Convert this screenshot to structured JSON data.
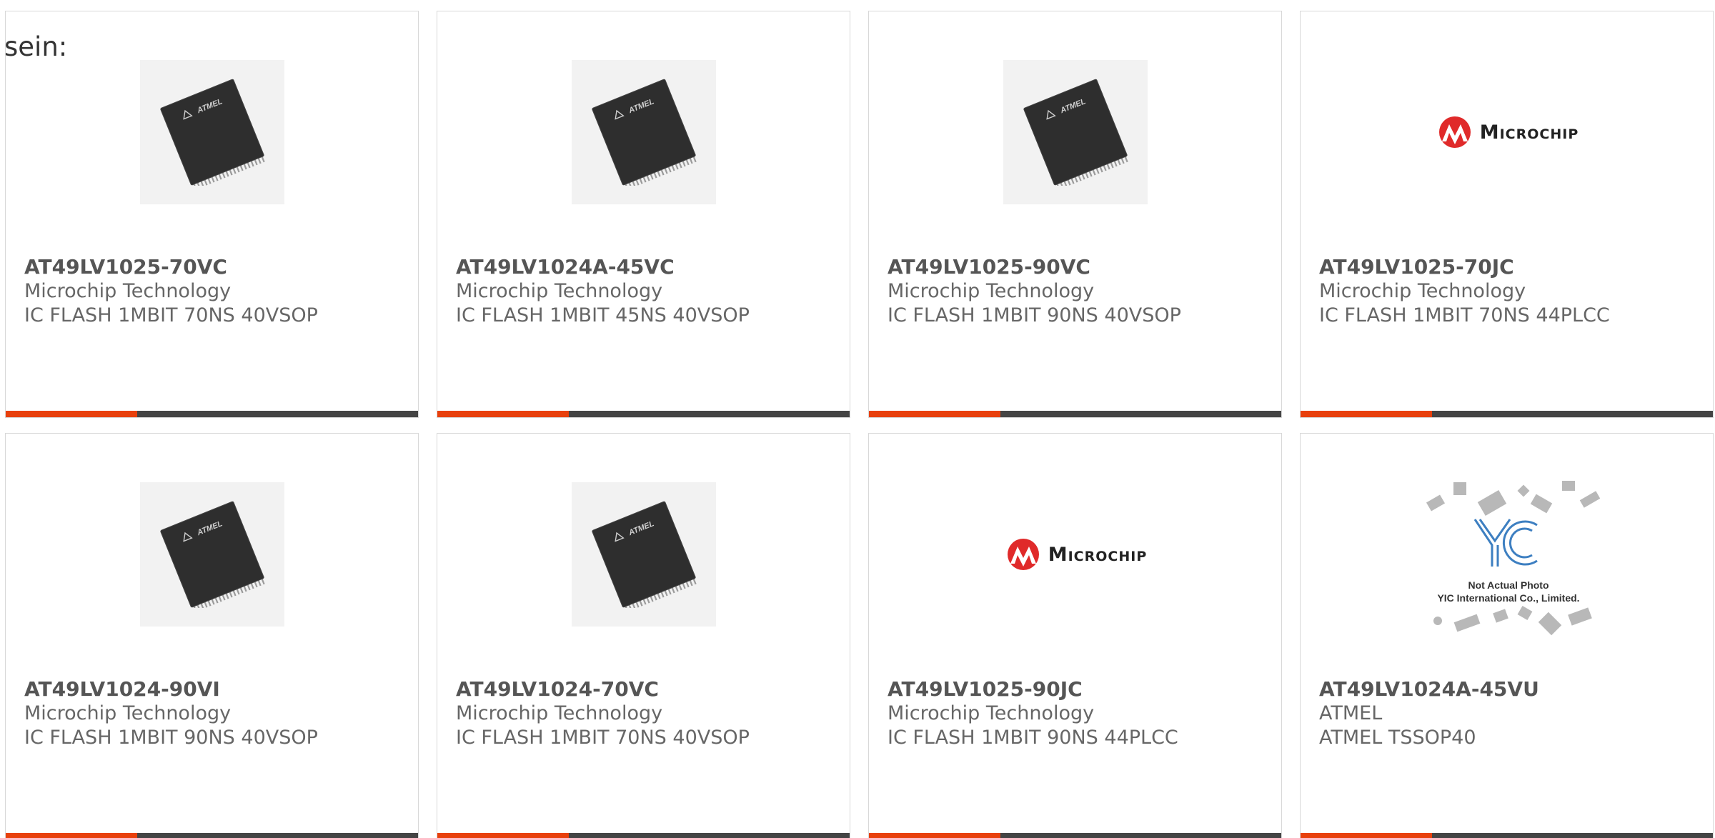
{
  "intro_text": "sein:",
  "colors": {
    "accent": "#e8400c",
    "bar": "#444444",
    "border": "#d8d8d8"
  },
  "products": [
    {
      "part": "AT49LV1025-70VC",
      "maker": "Microchip Technology",
      "desc": "IC FLASH 1MBIT 70NS 40VSOP",
      "image": "chip-photo"
    },
    {
      "part": "AT49LV1024A-45VC",
      "maker": "Microchip Technology",
      "desc": "IC FLASH 1MBIT 45NS 40VSOP",
      "image": "chip-photo"
    },
    {
      "part": "AT49LV1025-90VC",
      "maker": "Microchip Technology",
      "desc": "IC FLASH 1MBIT 90NS 40VSOP",
      "image": "chip-photo"
    },
    {
      "part": "AT49LV1025-70JC",
      "maker": "Microchip Technology",
      "desc": "IC FLASH 1MBIT 70NS 44PLCC",
      "image": "microchip-logo",
      "logo_text": "Microchip"
    },
    {
      "part": "AT49LV1024-90VI",
      "maker": "Microchip Technology",
      "desc": "IC FLASH 1MBIT 90NS 40VSOP",
      "image": "chip-photo"
    },
    {
      "part": "AT49LV1024-70VC",
      "maker": "Microchip Technology",
      "desc": "IC FLASH 1MBIT 70NS 40VSOP",
      "image": "chip-photo"
    },
    {
      "part": "AT49LV1025-90JC",
      "maker": "Microchip Technology",
      "desc": "IC FLASH 1MBIT 90NS 44PLCC",
      "image": "microchip-logo",
      "logo_text": "Microchip"
    },
    {
      "part": "AT49LV1024A-45VU",
      "maker": "ATMEL",
      "desc": "ATMEL TSSOP40",
      "image": "yic-placeholder",
      "placeholder_lines": [
        "Not Actual Photo",
        "YIC International Co., Limited."
      ]
    }
  ]
}
